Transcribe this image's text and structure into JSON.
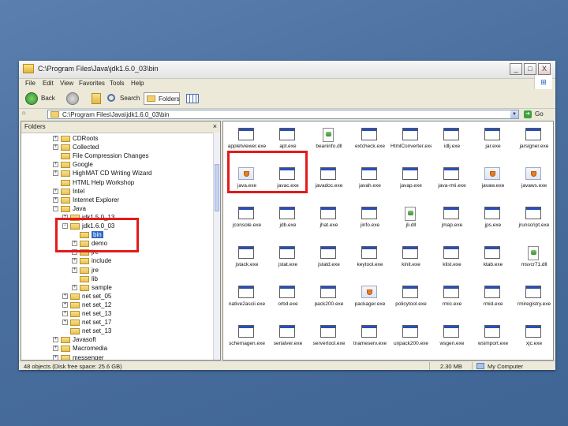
{
  "window": {
    "title": "C:\\Program Files\\Java\\jdk1.6.0_03\\bin",
    "buttons": {
      "minimize": "_",
      "maximize": "□",
      "close": "X"
    }
  },
  "menu": [
    "File",
    "Edit",
    "View",
    "Favorites",
    "Tools",
    "Help"
  ],
  "toolbar": {
    "back": "Back",
    "search": "Search",
    "folders": "Folders"
  },
  "address": {
    "value": "C:\\Program Files\\Java\\jdk1.6.0_03\\bin",
    "go": "Go"
  },
  "folders_pane": {
    "title": "Folders",
    "close": "×",
    "items": [
      {
        "label": "CDRoots",
        "depth": 0,
        "toggle": "+"
      },
      {
        "label": "Collected",
        "depth": 0,
        "toggle": "+"
      },
      {
        "label": "File Compression Changes",
        "depth": 0,
        "toggle": ""
      },
      {
        "label": "Google",
        "depth": 0,
        "toggle": "+"
      },
      {
        "label": "HighMAT CD Writing Wizard",
        "depth": 0,
        "toggle": "+"
      },
      {
        "label": "HTML Help Workshop",
        "depth": 0,
        "toggle": ""
      },
      {
        "label": "Intel",
        "depth": 0,
        "toggle": "+"
      },
      {
        "label": "Internet Explorer",
        "depth": 0,
        "toggle": "+"
      },
      {
        "label": "Java",
        "depth": 0,
        "toggle": "−"
      },
      {
        "label": "jdk1.5.0_13",
        "depth": 1,
        "toggle": "+"
      },
      {
        "label": "jdk1.6.0_03",
        "depth": 1,
        "toggle": "−"
      },
      {
        "label": "bin",
        "depth": 2,
        "toggle": "",
        "selected": true
      },
      {
        "label": "demo",
        "depth": 2,
        "toggle": "+"
      },
      {
        "label": "jre",
        "depth": 2,
        "toggle": "+"
      },
      {
        "label": "include",
        "depth": 2,
        "toggle": "+"
      },
      {
        "label": "jre",
        "depth": 2,
        "toggle": "+"
      },
      {
        "label": "lib",
        "depth": 2,
        "toggle": ""
      },
      {
        "label": "sample",
        "depth": 2,
        "toggle": "+"
      },
      {
        "label": "net set_05",
        "depth": 1,
        "toggle": "+"
      },
      {
        "label": "net set_12",
        "depth": 1,
        "toggle": "+"
      },
      {
        "label": "net set_13",
        "depth": 1,
        "toggle": "+"
      },
      {
        "label": "net set_17",
        "depth": 1,
        "toggle": "+"
      },
      {
        "label": "net set_13",
        "depth": 1,
        "toggle": ""
      },
      {
        "label": "Javasoft",
        "depth": 0,
        "toggle": "+"
      },
      {
        "label": "Macromedia",
        "depth": 0,
        "toggle": "+"
      },
      {
        "label": "messenger",
        "depth": 0,
        "toggle": "+"
      }
    ]
  },
  "files": [
    {
      "name": "appletviewer.exe",
      "icon": "exe"
    },
    {
      "name": "apt.exe",
      "icon": "exe"
    },
    {
      "name": "beaninfo.dll",
      "icon": "dll"
    },
    {
      "name": "extcheck.exe",
      "icon": "exe"
    },
    {
      "name": "HtmlConverter.exe",
      "icon": "exe"
    },
    {
      "name": "idlj.exe",
      "icon": "exe"
    },
    {
      "name": "jar.exe",
      "icon": "exe"
    },
    {
      "name": "jarsigner.exe",
      "icon": "exe"
    },
    {
      "name": "java.exe",
      "icon": "java"
    },
    {
      "name": "javac.exe",
      "icon": "exe"
    },
    {
      "name": "javadoc.exe",
      "icon": "exe"
    },
    {
      "name": "javah.exe",
      "icon": "exe"
    },
    {
      "name": "javap.exe",
      "icon": "exe"
    },
    {
      "name": "java-rmi.exe",
      "icon": "exe"
    },
    {
      "name": "javaw.exe",
      "icon": "java"
    },
    {
      "name": "javaws.exe",
      "icon": "java"
    },
    {
      "name": "jconsole.exe",
      "icon": "exe"
    },
    {
      "name": "jdb.exe",
      "icon": "exe"
    },
    {
      "name": "jhat.exe",
      "icon": "exe"
    },
    {
      "name": "jinfo.exe",
      "icon": "exe"
    },
    {
      "name": "jli.dll",
      "icon": "dll"
    },
    {
      "name": "jmap.exe",
      "icon": "exe"
    },
    {
      "name": "jps.exe",
      "icon": "exe"
    },
    {
      "name": "jrunscript.exe",
      "icon": "exe"
    },
    {
      "name": "jstack.exe",
      "icon": "exe"
    },
    {
      "name": "jstat.exe",
      "icon": "exe"
    },
    {
      "name": "jstatd.exe",
      "icon": "exe"
    },
    {
      "name": "keytool.exe",
      "icon": "exe"
    },
    {
      "name": "kinit.exe",
      "icon": "exe"
    },
    {
      "name": "klist.exe",
      "icon": "exe"
    },
    {
      "name": "ktab.exe",
      "icon": "exe"
    },
    {
      "name": "msvcr71.dll",
      "icon": "dll"
    },
    {
      "name": "native2ascii.exe",
      "icon": "exe"
    },
    {
      "name": "orbd.exe",
      "icon": "exe"
    },
    {
      "name": "pack200.exe",
      "icon": "exe"
    },
    {
      "name": "packager.exe",
      "icon": "java"
    },
    {
      "name": "policytool.exe",
      "icon": "exe"
    },
    {
      "name": "rmic.exe",
      "icon": "exe"
    },
    {
      "name": "rmid.exe",
      "icon": "exe"
    },
    {
      "name": "rmiregistry.exe",
      "icon": "exe"
    },
    {
      "name": "schemagen.exe",
      "icon": "exe"
    },
    {
      "name": "serialver.exe",
      "icon": "exe"
    },
    {
      "name": "servertool.exe",
      "icon": "exe"
    },
    {
      "name": "tnameserv.exe",
      "icon": "exe"
    },
    {
      "name": "unpack200.exe",
      "icon": "exe"
    },
    {
      "name": "wsgen.exe",
      "icon": "exe"
    },
    {
      "name": "wsimport.exe",
      "icon": "exe"
    },
    {
      "name": "xjc.exe",
      "icon": "exe"
    }
  ],
  "status": {
    "left": "48 objects (Disk free space: 25.6 GB)",
    "size": "2.30 MB",
    "zone": "My Computer"
  }
}
